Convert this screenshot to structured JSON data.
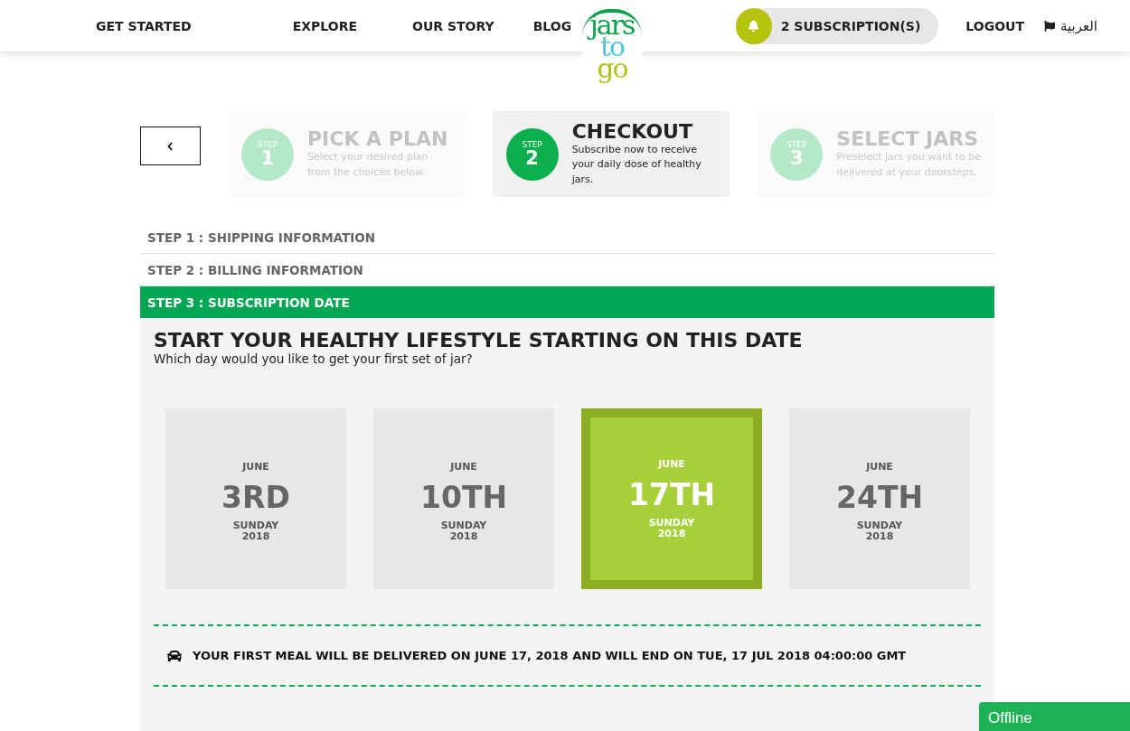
{
  "nav": {
    "left_links": [
      "GET STARTED",
      "EXPLORE",
      "OUR STORY",
      "BLOG"
    ],
    "logo": [
      "jars",
      "to",
      "go"
    ],
    "subscriptions": "2 SUBSCRIPTION(S)",
    "logout": "LOGOUT",
    "language": "العربية"
  },
  "steps": [
    {
      "step_label": "STEP",
      "number": "1",
      "title": "PICK A PLAN",
      "description": "Select your desired plan from the choices below.",
      "selected": false
    },
    {
      "step_label": "STEP",
      "number": "2",
      "title": "CHECKOUT",
      "description": "Subscribe now to receive your daily dose of healthy jars.",
      "selected": true
    },
    {
      "step_label": "STEP",
      "number": "3",
      "title": "SELECT JARS",
      "description": "Preselect jars you want to be delivered at your doorsteps.",
      "selected": false
    }
  ],
  "sections": [
    {
      "title": "STEP 1 : SHIPPING INFORMATION",
      "expanded": false
    },
    {
      "title": "STEP 2 : BILLING INFORMATION",
      "expanded": false
    },
    {
      "title": "STEP 3 : SUBSCRIPTION DATE",
      "expanded": true
    }
  ],
  "subscription_date": {
    "heading": "START YOUR HEALTHY LIFESTYLE STARTING ON THIS DATE",
    "subtitle": "Which day would you like to get your first set of jar?",
    "dates": [
      {
        "month": "JUNE",
        "day": "3RD",
        "weekday": "SUNDAY",
        "year": "2018",
        "selected": false
      },
      {
        "month": "JUNE",
        "day": "10TH",
        "weekday": "SUNDAY",
        "year": "2018",
        "selected": false
      },
      {
        "month": "JUNE",
        "day": "17TH",
        "weekday": "SUNDAY",
        "year": "2018",
        "selected": true
      },
      {
        "month": "JUNE",
        "day": "24TH",
        "weekday": "SUNDAY",
        "year": "2018",
        "selected": false
      }
    ],
    "delivery_note": "YOUR FIRST MEAL WILL BE DELIVERED ON JUNE 17, 2018 AND WILL END ON TUE, 17 JUL 2018 04:00:00 GMT"
  },
  "chat": {
    "status": "Offline"
  }
}
